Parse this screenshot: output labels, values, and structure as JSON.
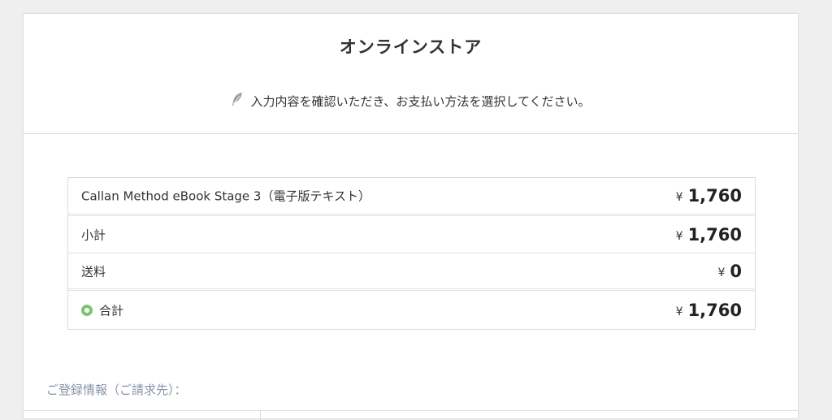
{
  "store": {
    "title": "オンラインストア",
    "instruction": "入力内容を確認いただき、お支払い方法を選択してください。",
    "instruction_icon": "feather-icon"
  },
  "order": {
    "product": {
      "name": "Callan Method eBook Stage 3（電子版テキスト）",
      "currency": "¥",
      "amount": "1,760"
    },
    "subtotal": {
      "label": "小計",
      "currency": "¥",
      "amount": "1,760"
    },
    "shipping": {
      "label": "送料",
      "currency": "¥",
      "amount": "0"
    },
    "total": {
      "label": "合計",
      "currency": "¥",
      "amount": "1,760",
      "icon": "circle-dot-icon"
    }
  },
  "registration": {
    "label": "ご登録情報（ご請求先）："
  },
  "colors": {
    "background": "#efefef",
    "panel": "#ffffff",
    "border": "#dcdcdc",
    "accent_green": "#7cc474",
    "muted_label": "#8a94a8",
    "feather": "#9aa59a"
  }
}
